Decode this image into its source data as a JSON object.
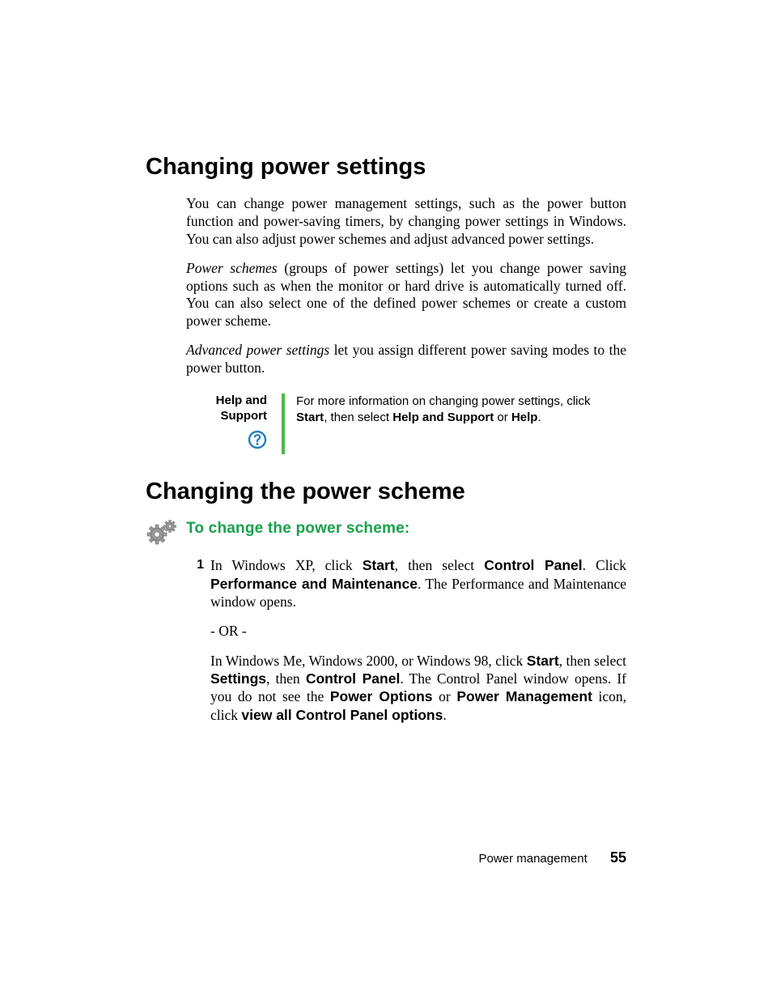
{
  "heading1": "Changing power settings",
  "intro_p1": "You can change power management settings, such as the power button function and power-saving timers, by changing power settings in Windows. You can also adjust power schemes and adjust advanced power settings.",
  "intro_p2_lead_italic": "Power schemes",
  "intro_p2_rest": " (groups of power settings) let you change power saving options such as when the monitor or hard drive is automatically turned off. You can also select one of the defined power schemes or create a custom power scheme.",
  "intro_p3_lead_italic": "Advanced power settings",
  "intro_p3_rest": " let you assign different power saving modes to the power button.",
  "callout": {
    "label_line1": "Help and",
    "label_line2": "Support",
    "text_prefix": "For more information on changing power settings, click ",
    "text_b1": "Start",
    "text_mid1": ", then select ",
    "text_b2": "Help and Support",
    "text_mid2": " or ",
    "text_b3": "Help",
    "text_suffix": "."
  },
  "heading2": "Changing the power scheme",
  "task_heading": "To change the power scheme:",
  "step1": {
    "num": "1",
    "a_pre": "In Windows XP, click ",
    "a_b1": "Start",
    "a_mid1": ", then select ",
    "a_b2": "Control Panel",
    "a_mid2": ". Click ",
    "a_b3": "Performance and Maintenance",
    "a_post": ". The Performance and Maintenance window opens.",
    "or": "- OR -",
    "b_pre": "In Windows Me, Windows 2000, or Windows 98, click ",
    "b_b1": "Start",
    "b_mid1": ", then select ",
    "b_b2": "Settings",
    "b_mid2": ", then ",
    "b_b3": "Control Panel",
    "b_mid3": ". The Control Panel window opens. If you do not see the ",
    "b_b4": "Power Options",
    "b_mid4": " or ",
    "b_b5": "Power Management",
    "b_mid5": " icon, click ",
    "b_b6": "view all Control Panel options",
    "b_post": "."
  },
  "footer": {
    "chapter": "Power management",
    "page": "55"
  }
}
